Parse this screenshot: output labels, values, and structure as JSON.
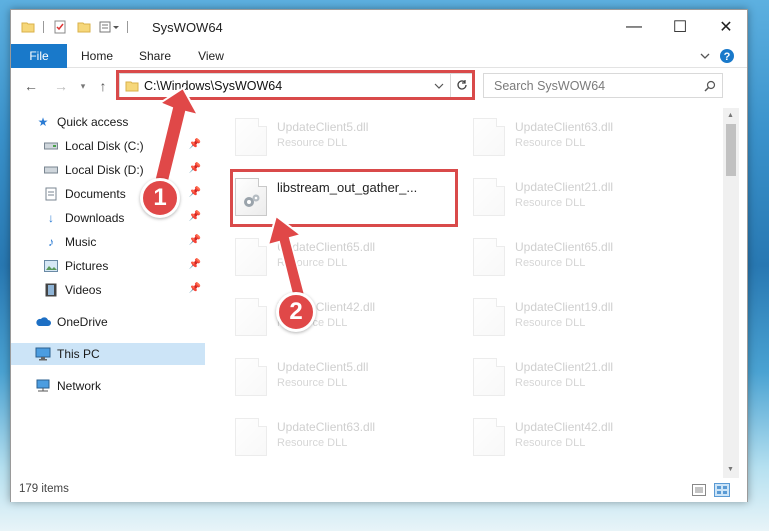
{
  "window": {
    "title": "SysWOW64",
    "controls": {
      "minimize": "—",
      "maximize": "☐",
      "close": "✕"
    }
  },
  "ribbon": {
    "tabs": [
      "File",
      "Home",
      "Share",
      "View"
    ],
    "expand_icon": "chevron-down-icon",
    "help_icon": "help-icon"
  },
  "navigation": {
    "address_path": "C:\\Windows\\SysWOW64",
    "search_placeholder": "Search SysWOW64"
  },
  "sidebar": {
    "items": [
      {
        "label": "Quick access",
        "icon": "star-icon",
        "pinned": false
      },
      {
        "label": "Local Disk (C:)",
        "icon": "drive-icon",
        "pinned": true
      },
      {
        "label": "Local Disk (D:)",
        "icon": "drive-icon",
        "pinned": true
      },
      {
        "label": "Documents",
        "icon": "documents-icon",
        "pinned": true
      },
      {
        "label": "Downloads",
        "icon": "downloads-icon",
        "pinned": true
      },
      {
        "label": "Music",
        "icon": "music-icon",
        "pinned": true
      },
      {
        "label": "Pictures",
        "icon": "pictures-icon",
        "pinned": true
      },
      {
        "label": "Videos",
        "icon": "videos-icon",
        "pinned": true
      },
      {
        "label": "OneDrive",
        "icon": "cloud-icon",
        "pinned": false
      },
      {
        "label": "This PC",
        "icon": "computer-icon",
        "pinned": false,
        "selected": true
      },
      {
        "label": "Network",
        "icon": "network-icon",
        "pinned": false
      }
    ]
  },
  "files": {
    "left_column": [
      {
        "name": "UpdateClient5.dll",
        "type": "Resource DLL"
      },
      {
        "name": "libstream_out_gather_...",
        "type": ""
      },
      {
        "name": "UpdateClient65.dll",
        "type": "Resource DLL"
      },
      {
        "name": "UpdateClient42.dll",
        "type": "Resource DLL"
      },
      {
        "name": "UpdateClient5.dll",
        "type": "Resource DLL"
      },
      {
        "name": "UpdateClient63.dll",
        "type": "Resource DLL"
      }
    ],
    "right_column": [
      {
        "name": "UpdateClient63.dll",
        "type": "Resource DLL"
      },
      {
        "name": "UpdateClient21.dll",
        "type": "Resource DLL"
      },
      {
        "name": "UpdateClient65.dll",
        "type": "Resource DLL"
      },
      {
        "name": "UpdateClient19.dll",
        "type": "Resource DLL"
      },
      {
        "name": "UpdateClient21.dll",
        "type": "Resource DLL"
      },
      {
        "name": "UpdateClient42.dll",
        "type": "Resource DLL"
      }
    ]
  },
  "status": {
    "item_count": "179 items"
  },
  "callouts": {
    "step1": "1",
    "step2": "2"
  },
  "colors": {
    "accent": "#1979ca",
    "highlight": "#d94a4a",
    "selected": "#cce4f7"
  }
}
